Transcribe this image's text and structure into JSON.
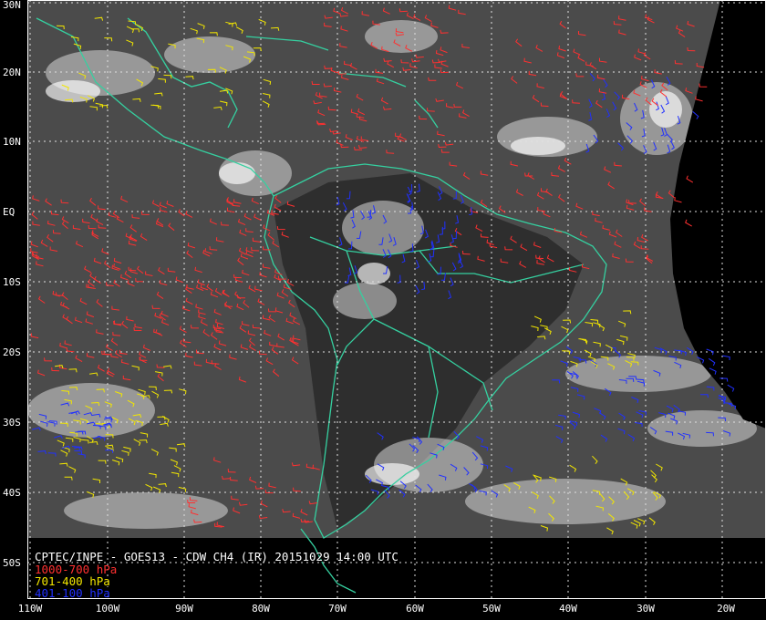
{
  "title": "CPTEC/INPE - GOES13 - CDW CH4 (IR) 20151029 14:00 UTC",
  "legend": [
    {
      "label": "1000-700 hPa",
      "color": "#ff3030"
    },
    {
      "label": "701-400 hPa",
      "color": "#f2e600"
    },
    {
      "label": "401-100 hPa",
      "color": "#2030ff"
    }
  ],
  "lat_labels": [
    "30N",
    "20N",
    "10N",
    "EQ",
    "10S",
    "20S",
    "30S",
    "40S",
    "50S"
  ],
  "lon_labels": [
    "110W",
    "100W",
    "90W",
    "80W",
    "70W",
    "60W",
    "50W",
    "40W",
    "30W",
    "20W"
  ],
  "colors": {
    "coastline": "#35d0a0",
    "grid": "#e0e0e0",
    "background": "#000000",
    "imagery": "#4a4a4a"
  }
}
